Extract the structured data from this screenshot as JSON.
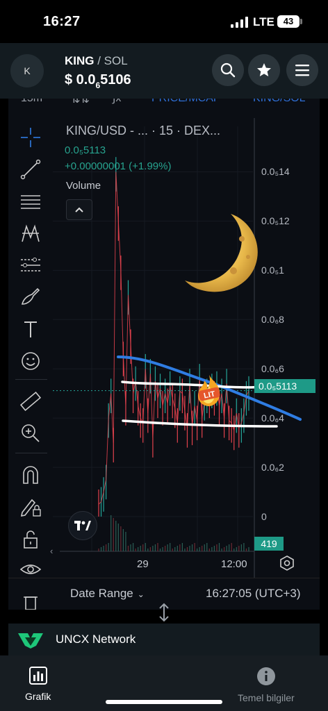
{
  "status_bar": {
    "time": "16:27",
    "network": "LTE",
    "battery": "43"
  },
  "header": {
    "avatar_letter": "K",
    "base": "KING",
    "separator": " / ",
    "quote": "SOL",
    "price_prefix": "$ 0.0",
    "price_sub": "6",
    "price_rest": "5106"
  },
  "toolbar_top": {
    "interval": "15m",
    "price_mcap": "PRICE/MCAP",
    "pair": "KING/SOL"
  },
  "chart_info": {
    "title": "KING/USD - ... · 15 · DEX...",
    "value": "0.0₅5113",
    "change": "+0.00000001 (+1.99%)",
    "volume_label": "Volume"
  },
  "chart_data": {
    "type": "line",
    "y_tick_labels": [
      "0.0₅14",
      "0.0₅12",
      "0.0₅1",
      "0.0₆8",
      "0.0₆6",
      "0.0₆4",
      "0.0₆2",
      "0"
    ],
    "y_ticks": [
      14,
      12,
      10,
      8,
      6,
      4,
      2,
      0
    ],
    "ylim": [
      0,
      15
    ],
    "x_tick_labels": [
      "29",
      "12:00"
    ],
    "last_price_label": "0.0₅5113",
    "last_price": 5.113,
    "volume_label": "419",
    "series": [
      {
        "values": [
          0.5,
          0.6,
          1.0,
          1.5,
          4.0,
          5.0,
          3.0,
          14.0,
          12.0,
          10.0,
          6.5,
          4.5,
          9.0,
          7.0,
          5.0,
          5.5,
          4.5,
          4.0,
          3.8,
          6.0,
          4.2,
          5.8,
          3.2,
          5.5,
          4.8,
          5.2,
          4.5,
          5.0,
          4.6,
          5.3,
          4.8,
          4.4,
          3.8,
          5.1,
          5.0,
          4.3,
          3.6,
          5.4,
          3.7,
          4.5,
          3.9,
          5.6,
          4.0,
          4.7,
          5.0,
          4.8,
          5.2,
          4.9,
          5.3,
          4.5,
          5.0,
          4.0,
          5.4,
          3.9,
          3.8,
          3.5,
          4.2,
          3.6,
          3.8,
          4.2,
          4.9,
          5.1
        ],
        "color": "#e3424d"
      }
    ],
    "annotations": {
      "trendline_color": "#2f7de3",
      "support_color": "#ffffff",
      "sticker_text": "LIT"
    }
  },
  "footer": {
    "date_range": "Date Range",
    "clock": "16:27:05 (UTC+3)"
  },
  "pair_row": {
    "name": "UNCX Network"
  },
  "bottom_nav": {
    "tab1": "Grafik",
    "tab2": "Temel bilgiler"
  }
}
